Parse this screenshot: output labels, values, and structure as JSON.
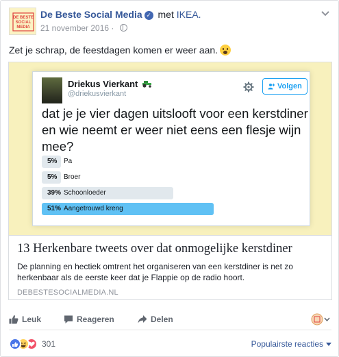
{
  "post": {
    "page_name": "De Beste Social Media",
    "with_label": "met",
    "with_target": "IKEA.",
    "date": "21 november 2016",
    "separator": "·",
    "text": "Zet je schrap, de feestdagen komen er weer aan.",
    "avatar_text": [
      "DE BESTE",
      "SOCIAL",
      "MEDIA"
    ]
  },
  "tweet": {
    "name": "Driekus Vierkant",
    "handle": "@driekusvierkant",
    "follow_label": "Volgen",
    "text": "dat je je vier dagen uitslooft voor een kerstdiner en wie neemt er weer niet eens een flesje wijn mee?",
    "poll": [
      {
        "percent_label": "5%",
        "percent": 5,
        "label": "Pa",
        "winner": false
      },
      {
        "percent_label": "5%",
        "percent": 5,
        "label": "Broer",
        "winner": false
      },
      {
        "percent_label": "39%",
        "percent": 39,
        "label": "Schoonloeder",
        "winner": false
      },
      {
        "percent_label": "51%",
        "percent": 51,
        "label": "Aangetrouwd kreng",
        "winner": true
      }
    ]
  },
  "link": {
    "title": "13 Herkenbare tweets over dat onmogelijke kerstdiner",
    "description": "De planning en hectiek omtrent het organiseren van een kerstdiner is net zo herkenbaar als de eerste keer dat je Flappie op de radio hoort.",
    "domain": "DEBESTESOCIALMEDIA.NL"
  },
  "actions": {
    "like": "Leuk",
    "comment": "Reageren",
    "share": "Delen"
  },
  "reactions": {
    "count": "301",
    "sort_label": "Populairste reacties"
  },
  "colors": {
    "facebook_link": "#365899",
    "twitter_blue": "#1da1f2",
    "poll_winner": "#60c1f4",
    "poll_bar": "#e1e8ed",
    "link_image_bg": "#f8f1bd"
  }
}
